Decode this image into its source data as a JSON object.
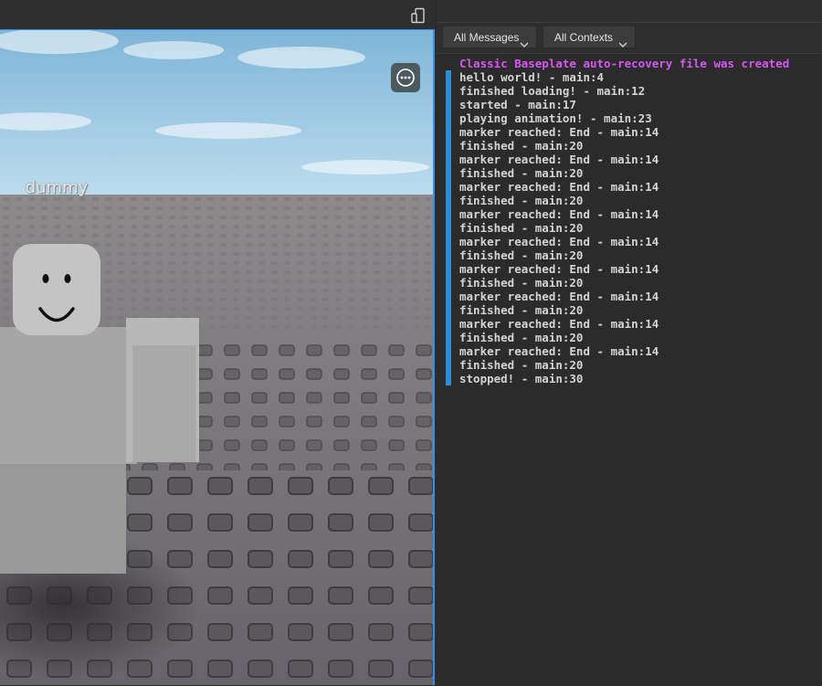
{
  "viewport": {
    "character_label": "dummy",
    "icons": {
      "device_toggle": "device-emulator-icon",
      "more_menu": "more-menu-icon"
    },
    "colors": {
      "frame_border": "#3a8ee6",
      "sky_top": "#7eb3d6",
      "sky_bottom": "#b9d9ec",
      "baseplate": "#6d6a6c",
      "character": "#a3a3a3"
    }
  },
  "output": {
    "filters": {
      "messages": {
        "selected": "All Messages"
      },
      "contexts": {
        "selected": "All Contexts"
      }
    },
    "colors": {
      "info_text": "#d4d4d4",
      "system_text": "#d558f0",
      "marker": "#2a8fd4"
    },
    "lines": [
      {
        "text": "Classic Baseplate auto-recovery file was created",
        "kind": "system"
      },
      {
        "text": "hello world! - main:4",
        "kind": "info"
      },
      {
        "text": "finished loading! - main:12",
        "kind": "info"
      },
      {
        "text": "started - main:17",
        "kind": "info"
      },
      {
        "text": "playing animation! - main:23",
        "kind": "info"
      },
      {
        "text": "marker reached: End - main:14",
        "kind": "info"
      },
      {
        "text": "finished - main:20",
        "kind": "info"
      },
      {
        "text": "marker reached: End - main:14",
        "kind": "info"
      },
      {
        "text": "finished - main:20",
        "kind": "info"
      },
      {
        "text": "marker reached: End - main:14",
        "kind": "info"
      },
      {
        "text": "finished - main:20",
        "kind": "info"
      },
      {
        "text": "marker reached: End - main:14",
        "kind": "info"
      },
      {
        "text": "finished - main:20",
        "kind": "info"
      },
      {
        "text": "marker reached: End - main:14",
        "kind": "info"
      },
      {
        "text": "finished - main:20",
        "kind": "info"
      },
      {
        "text": "marker reached: End - main:14",
        "kind": "info"
      },
      {
        "text": "finished - main:20",
        "kind": "info"
      },
      {
        "text": "marker reached: End - main:14",
        "kind": "info"
      },
      {
        "text": "finished - main:20",
        "kind": "info"
      },
      {
        "text": "marker reached: End - main:14",
        "kind": "info"
      },
      {
        "text": "finished - main:20",
        "kind": "info"
      },
      {
        "text": "marker reached: End - main:14",
        "kind": "info"
      },
      {
        "text": "finished - main:20",
        "kind": "info"
      },
      {
        "text": "stopped! - main:30",
        "kind": "info"
      }
    ]
  }
}
